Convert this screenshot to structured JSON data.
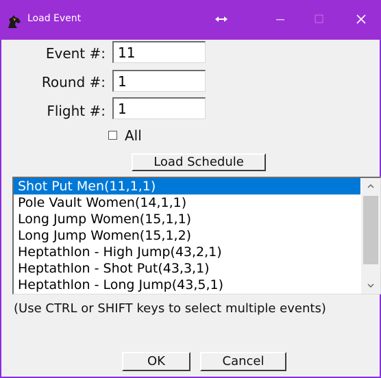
{
  "window": {
    "title": "Load Event",
    "accent_color": "#9b2fd6",
    "icon": "horse-head-icon"
  },
  "titlebar": {
    "move_icon": "resize-horizontal-icon",
    "minimize_icon": "minimize-icon",
    "maximize_icon": "maximize-icon",
    "close_icon": "close-icon"
  },
  "form": {
    "event_label": "Event #:",
    "event_value": "11",
    "round_label": "Round #:",
    "round_value": "1",
    "flight_label": "Flight #:",
    "flight_value": "1",
    "all_label": "All",
    "all_checked": false,
    "load_schedule_label": "Load Schedule"
  },
  "events": {
    "items": [
      "Shot Put Men(11,1,1)",
      "Pole Vault Women(14,1,1)",
      "Long Jump Women(15,1,1)",
      "Long Jump Women(15,1,2)",
      "Heptathlon - High Jump(43,2,1)",
      "Heptathlon - Shot Put(43,3,1)",
      "Heptathlon - Long Jump(43,5,1)"
    ],
    "selected_index": 0,
    "selection_color": "#0078d7"
  },
  "hint": "(Use CTRL or SHIFT keys to select multiple events)",
  "actions": {
    "ok_label": "OK",
    "cancel_label": "Cancel"
  }
}
